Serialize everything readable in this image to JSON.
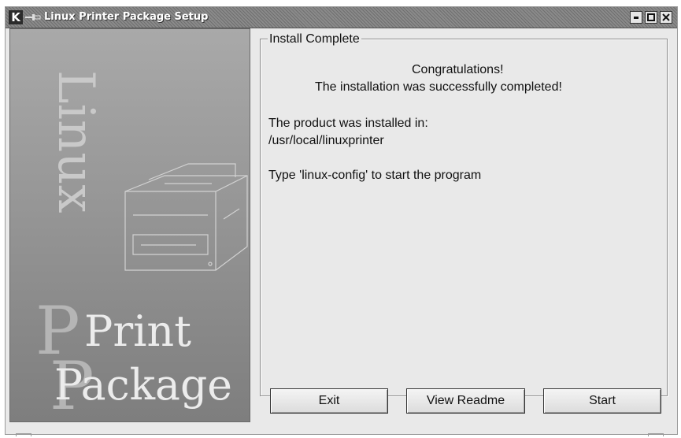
{
  "window": {
    "title": "Linux Printer Package Setup",
    "app_icon": "k-icon",
    "controls": [
      "minimize",
      "maximize",
      "close"
    ]
  },
  "sidebar": {
    "word_linux": "Linux",
    "logo_print": "Print",
    "logo_package": "Package",
    "image": "printer-illustration"
  },
  "main": {
    "group_title": "Install Complete",
    "congrats": "Congratulations!",
    "success": "The installation was successfully completed!",
    "installed_label": "The product was installed in:",
    "install_path": "/usr/local/linuxprinter",
    "hint": "Type 'linux-config' to start the program"
  },
  "buttons": {
    "exit": "Exit",
    "readme": "View Readme",
    "start": "Start"
  }
}
